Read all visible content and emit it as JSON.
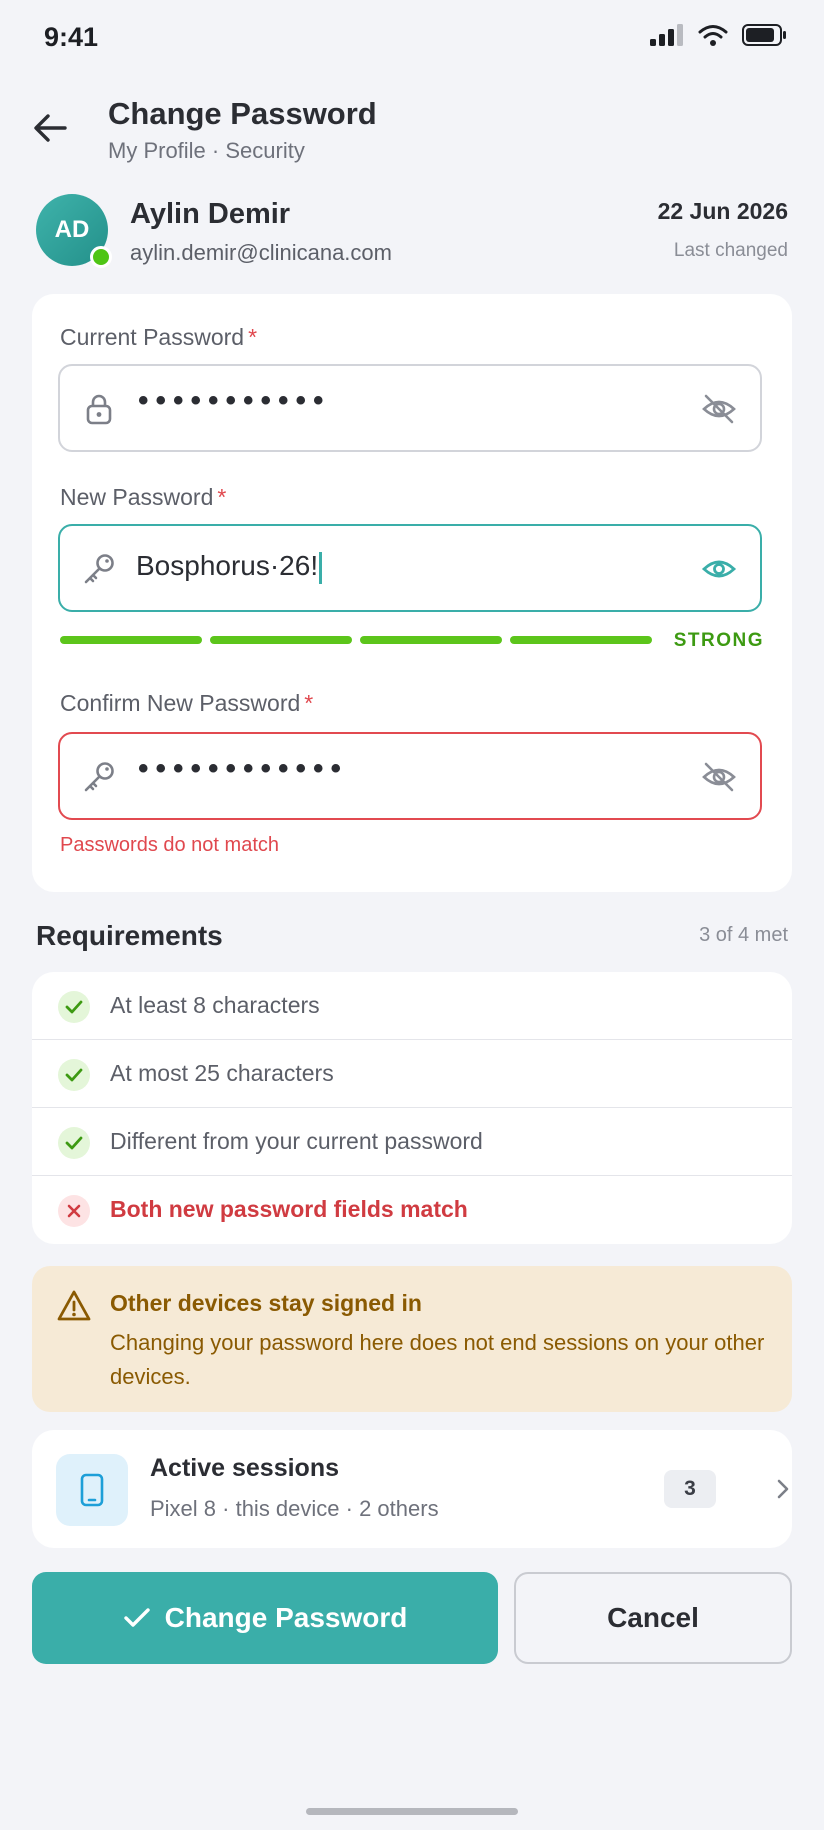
{
  "status_bar": {
    "time": "9:41"
  },
  "header": {
    "title": "Change Password",
    "breadcrumb": "My Profile · Security"
  },
  "profile": {
    "initials": "AD",
    "name": "Aylin Demir",
    "email": "aylin.demir@clinicana.com",
    "last_changed_date": "22 Jun 2026",
    "last_changed_label": "Last changed"
  },
  "form": {
    "required_mark": "*",
    "current": {
      "label": "Current Password",
      "masked_value": "•••••••••••"
    },
    "new": {
      "label": "New Password",
      "value": "Bosphorus·26!",
      "strength_label": "STRONG",
      "strength_level": 4,
      "strength_max": 4
    },
    "confirm": {
      "label": "Confirm New Password",
      "masked_value": "••••••••••••",
      "error": "Passwords do not match"
    }
  },
  "requirements": {
    "heading": "Requirements",
    "count_label": "3 of 4 met",
    "items": [
      {
        "text": "At least 8 characters",
        "met": true
      },
      {
        "text": "At most 25 characters",
        "met": true
      },
      {
        "text": "Different from your current password",
        "met": true
      },
      {
        "text": "Both new password fields match",
        "met": false
      }
    ]
  },
  "warning": {
    "title": "Other devices stay signed in",
    "body": "Changing your password here does not end sessions on your other devices."
  },
  "sessions": {
    "title": "Active sessions",
    "subtitle": "Pixel 8 · this device · 2 others",
    "count": "3"
  },
  "actions": {
    "primary_label": "Change Password",
    "secondary_label": "Cancel"
  },
  "colors": {
    "accent": "#3aaea9",
    "error": "#e24a50",
    "success": "#5cc51b",
    "warning_bg": "#f6ead6"
  }
}
